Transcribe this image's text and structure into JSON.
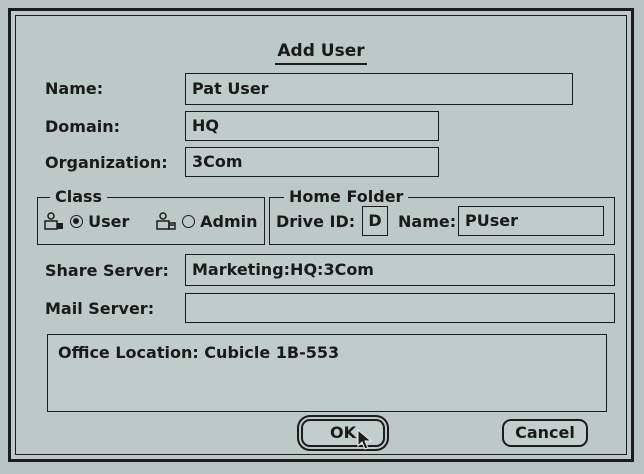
{
  "dialog": {
    "title": "Add User",
    "name_label": "Name:",
    "name_value": "Pat User",
    "domain_label": "Domain:",
    "domain_value": "HQ",
    "org_label": "Organization:",
    "org_value": "3Com",
    "class_group": {
      "legend": "Class",
      "user_label": "User",
      "admin_label": "Admin",
      "selected": "User"
    },
    "home_folder": {
      "legend": "Home Folder",
      "drive_label": "Drive ID:",
      "drive_value": "D",
      "name_label": "Name:",
      "name_value": "PUser"
    },
    "share_server_label": "Share Server:",
    "share_server_value": "Marketing:HQ:3Com",
    "mail_server_label": "Mail Server:",
    "mail_server_value": "",
    "office_location_text": "Office Location: Cubicle 1B-553",
    "ok_label": "OK",
    "cancel_label": "Cancel"
  },
  "icons": [
    "user-icon",
    "admin-icon",
    "mouse-cursor-icon"
  ]
}
